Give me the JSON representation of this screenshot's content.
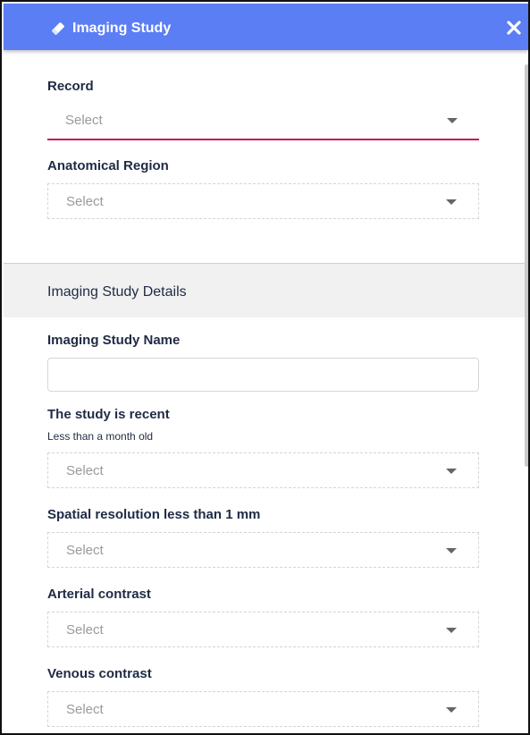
{
  "header": {
    "title": "Imaging Study",
    "icon": "eraser-icon",
    "close_icon": "close-icon",
    "background": "#5b7ef5"
  },
  "form": {
    "record": {
      "label": "Record",
      "placeholder": "Select"
    },
    "anatomical_region": {
      "label": "Anatomical Region",
      "placeholder": "Select"
    },
    "section": {
      "title": "Imaging Study Details"
    },
    "study_name": {
      "label": "Imaging Study Name",
      "value": ""
    },
    "study_recent": {
      "label": "The study is recent",
      "hint": "Less than a month old",
      "placeholder": "Select"
    },
    "spatial_resolution": {
      "label": "Spatial resolution less than 1 mm",
      "placeholder": "Select"
    },
    "arterial_contrast": {
      "label": "Arterial contrast",
      "placeholder": "Select"
    },
    "venous_contrast": {
      "label": "Venous contrast",
      "placeholder": "Select"
    }
  },
  "colors": {
    "accent_underline": "#c2185b",
    "label_text": "#1f2a44",
    "placeholder_text": "#9a9a9a"
  }
}
